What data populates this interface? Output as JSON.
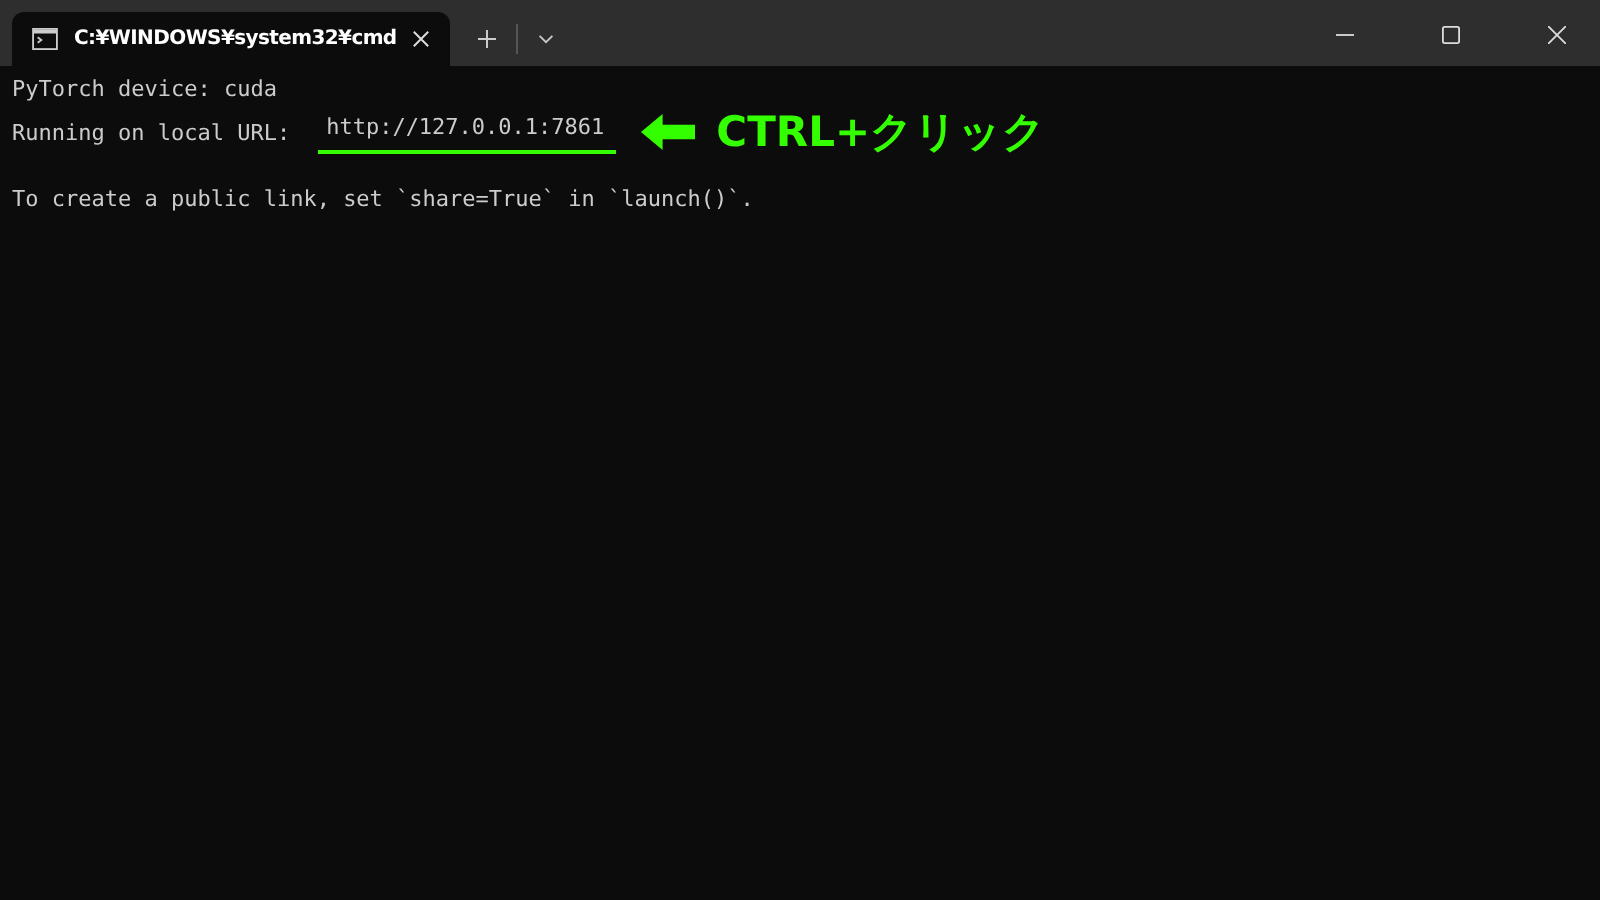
{
  "tabs": [
    {
      "title": "C:¥WINDOWS¥system32¥cmd",
      "selected": true
    }
  ],
  "output": [
    {
      "lines": [
        {
          "text": "PyTorch device: cuda"
        },
        {
          "text": "Running on local URL:",
          "url": "http://127.0.0.1:7861"
        }
      ]
    },
    {
      "lines": [
        {
          "text": "To create a public link, set `share=True` in `launch()`."
        }
      ]
    }
  ],
  "annotation": {
    "label": "CTRL+クリック"
  }
}
